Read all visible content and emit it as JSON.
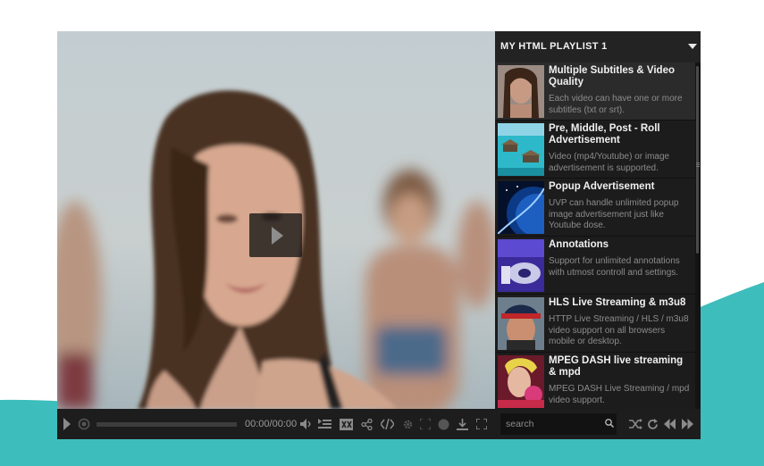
{
  "player": {
    "time_display": "00:00/00:00",
    "progress": 0,
    "controls": [
      "play-icon",
      "rewind-icon",
      "volume-icon",
      "playlist-icon",
      "subtitles-icon",
      "share-icon",
      "embed-icon",
      "settings-icon",
      "fullscreen-window-icon",
      "quality-icon",
      "download-icon",
      "fullscreen-icon"
    ]
  },
  "playlist": {
    "title": "MY HTML PLAYLIST 1",
    "items": [
      {
        "title": "Multiple Subtitles & Video Quality",
        "description": "Each video can have one or more subtitles (txt or srt).",
        "active": true
      },
      {
        "title": "Pre, Middle, Post - Roll Advertisement",
        "description": "Video (mp4/Youtube) or image advertisement is supported."
      },
      {
        "title": "Popup Advertisement",
        "description": "UVP can handle unlimited popup image advertisement just like Youtube dose."
      },
      {
        "title": "Annotations",
        "description": "Support for unlimited annotations with utmost controll and settings."
      },
      {
        "title": "HLS Live Streaming & m3u8",
        "description": "HTTP Live Streaming / HLS / m3u8 video support on all browsers mobile or desktop."
      },
      {
        "title": "MPEG DASH live streaming & mpd",
        "description": "MPEG DASH Live Streaming / mpd video support."
      }
    ],
    "search": {
      "placeholder": "search",
      "value": ""
    },
    "controls": [
      "shuffle-icon",
      "loop-icon",
      "previous-icon",
      "next-icon"
    ]
  },
  "colors": {
    "accent_wave": "#3dbdbb",
    "player_bg": "#1d1d1d",
    "playlist_bg": "#1b1b1b"
  }
}
